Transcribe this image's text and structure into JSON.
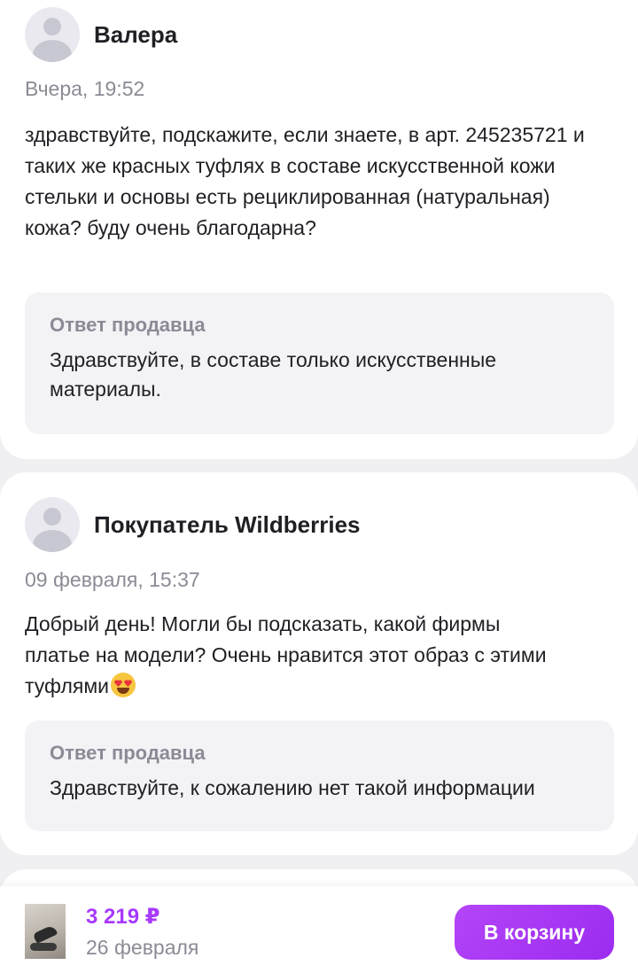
{
  "reviews": [
    {
      "author": "Валера",
      "date": "Вчера, 19:52",
      "question": "здравствуйте, подскажите, если знаете, в арт. 245235721 и таких же красных туфлях в составе искусственной кожи стельки и основы есть рециклированная (натуральная) кожа? буду очень благодарна?",
      "answer_label": "Ответ продавца",
      "answer": "Здравствуйте, в составе только искусственные материалы."
    },
    {
      "author": "Покупатель Wildberries",
      "date": "09 февраля, 15:37",
      "question": "Добрый день! Могли бы подсказать, какой фирмы платье на модели? Очень нравится этот образ с этими туфлями",
      "question_emoji": "heart-eyes-emoji",
      "answer_label": "Ответ продавца",
      "answer": "Здравствуйте, к сожалению нет такой информации"
    }
  ],
  "bottom_bar": {
    "price": "3 219 ₽",
    "delivery": "26 февраля",
    "cart_button": "В корзину",
    "accent_color": "#a73afd"
  },
  "colors": {
    "background": "#f0f0f3",
    "card": "#ffffff",
    "answer_bg": "#f3f3f6",
    "muted_text": "#8b8b96",
    "text": "#1f1f24"
  }
}
